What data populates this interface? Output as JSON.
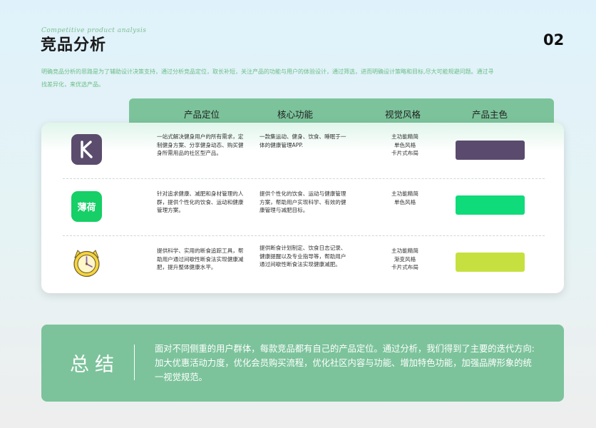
{
  "header": {
    "subtitle_en": "Competitive product analysis",
    "title": "竞品分析",
    "page_number": "02"
  },
  "intro": "明确竞品分析的思路是为了辅助设计决策支持，通过分析竞品定位，取长补短，关注产品的功能与用户的体验设计，通过筛选，进而明确设计策略和目标,尽大可能规避问题。通过寻找差异化，来优选产品。",
  "table": {
    "columns": [
      "产品定位",
      "核心功能",
      "视觉风格",
      "产品主色"
    ],
    "rows": [
      {
        "logo_icon": "keep-app-icon",
        "logo_text": "K",
        "positioning": "一站式解决健身用户的所有需求，定制健身方案、分享健身动态、购买健身所需用品的社区型产品。",
        "core_function": "一款集运动、健身、饮食、睡眠于一体的健康管理APP.",
        "visual_style": [
          "主功能精简",
          "单色风格",
          "卡片式布局"
        ],
        "main_color": "#5a4a6e"
      },
      {
        "logo_icon": "bohe-app-icon",
        "logo_text": "薄荷",
        "positioning": "针对追求健康、减肥和身材管理的人群，提供个性化的饮食、运动和健康管理方案。",
        "core_function": "提供个性化的饮食、运动与健康管理方案，帮助用户实现科学、有效的健康管理与减肥目标。",
        "visual_style": [
          "主功能精简",
          "单色风格"
        ],
        "main_color": "#0fdb7a"
      },
      {
        "logo_icon": "fasting-clock-cat-icon",
        "logo_text": "",
        "positioning": "提供科学、实用的断食追踪工具，帮助用户通过间歇性断食法实现健康减肥，提升整体健康水平。",
        "core_function": "提供断食计划制定、饮食日志记录、健康提醒以及专业指导等，帮助用户通过间歇性断食法实现健康减肥。",
        "visual_style": [
          "主功能精简",
          "渐变风格",
          "卡片式布局"
        ],
        "main_color": "#c6e13f"
      }
    ]
  },
  "summary": {
    "label": "总结",
    "text": "面对不同侧重的用户群体，每款竞品都有自己的产品定位。通过分析，我们得到了主要的迭代方向:加大优惠活动力度，优化会员购买流程，优化社区内容与功能、增加特色功能，加强品牌形象的统一视觉规范。"
  }
}
